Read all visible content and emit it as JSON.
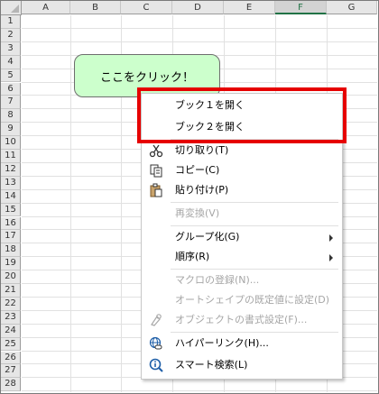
{
  "columns": [
    "A",
    "B",
    "C",
    "D",
    "E",
    "F",
    "G"
  ],
  "selected_column": "F",
  "rows": [
    "1",
    "2",
    "3",
    "4",
    "5",
    "6",
    "7",
    "8",
    "9",
    "10",
    "11",
    "12",
    "13",
    "14",
    "15",
    "16",
    "17",
    "18",
    "19",
    "20",
    "21",
    "22",
    "23",
    "24",
    "25",
    "26",
    "27",
    "28"
  ],
  "shape_text": "ここをクリック！",
  "menu": {
    "open_book1": "ブック１を開く",
    "open_book2": "ブック２を開く",
    "cut": "切り取り(T)",
    "copy": "コピー(C)",
    "paste": "貼り付け(P)",
    "reconvert": "再変換(V)",
    "group": "グループ化(G)",
    "order": "順序(R)",
    "assign_macro": "マクロの登録(N)...",
    "set_default": "オートシェイプの既定値に設定(D)",
    "format_object": "オブジェクトの書式設定(F)...",
    "hyperlink": "ハイパーリンク(H)...",
    "smart_lookup": "スマート検索(L)"
  },
  "colors": {
    "highlight": "#e60000",
    "shape_fill": "#ccffcc",
    "accent": "#217346"
  }
}
